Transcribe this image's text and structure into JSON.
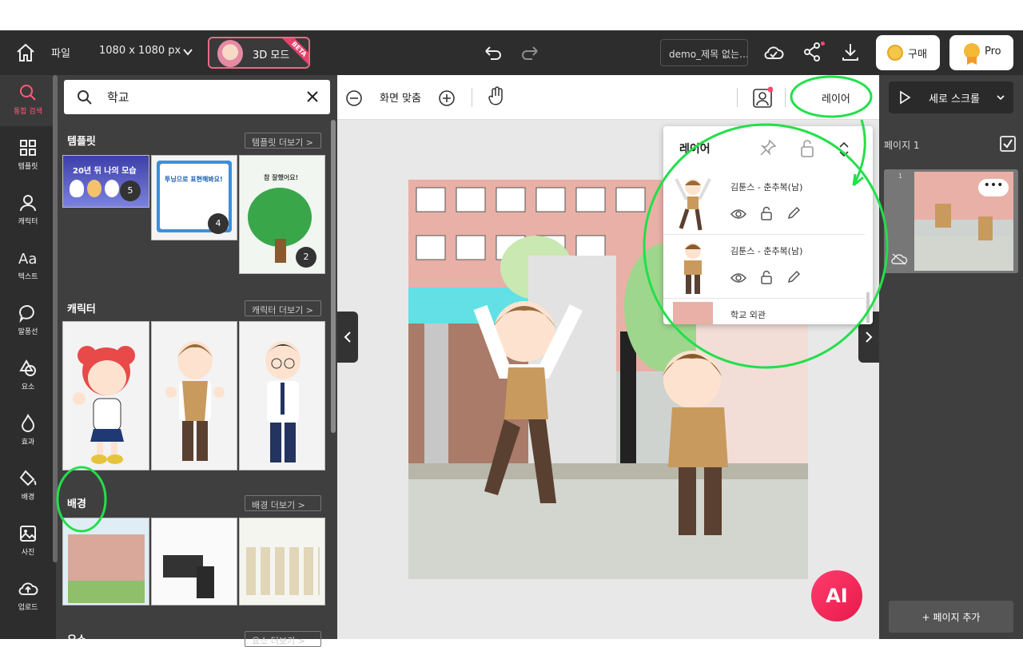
{
  "topbar": {
    "file": "파일",
    "canvas_size": "1080 x 1080 px",
    "mode_3d": "3D 모드",
    "beta": "BETA",
    "doc_title": "demo_제목 없는…",
    "buy": "구매",
    "pro": "Pro"
  },
  "nav": [
    {
      "label": "통합 검색",
      "icon": "search-icon",
      "active": true
    },
    {
      "label": "템플릿",
      "icon": "grid-icon"
    },
    {
      "label": "캐릭터",
      "icon": "person-icon"
    },
    {
      "label": "텍스트",
      "icon": "text-icon"
    },
    {
      "label": "말풍선",
      "icon": "speech-bubble-icon"
    },
    {
      "label": "요소",
      "icon": "shapes-icon"
    },
    {
      "label": "효과",
      "icon": "flame-icon"
    },
    {
      "label": "배경",
      "icon": "paint-bucket-icon"
    },
    {
      "label": "사진",
      "icon": "image-icon"
    },
    {
      "label": "업로드",
      "icon": "upload-cloud-icon"
    }
  ],
  "search": {
    "query": "학교"
  },
  "sections": {
    "templates": {
      "title": "템플릿",
      "more": "템플릿 더보기 >",
      "counts": [
        "5",
        "4",
        "2"
      ],
      "template1_text": "20년 뒤 나의 모습",
      "template2_text": "투닝으로 표현해봐요!",
      "template3_text": "참 잘했어요!"
    },
    "characters": {
      "title": "캐릭터",
      "more": "캐릭터 더보기 >"
    },
    "backgrounds": {
      "title": "배경",
      "more": "배경 더보기 >"
    },
    "next": {
      "title": "요소",
      "more": "요소 더보기 >"
    }
  },
  "canvas_toolbar": {
    "fit": "화면 맞춤",
    "layer": "레이어"
  },
  "layers_panel": {
    "title": "레이어",
    "rows": [
      {
        "name": "김툰스 - 춘추복(남)"
      },
      {
        "name": "김툰스 - 춘추복(남)"
      },
      {
        "name": "학교 외관"
      }
    ]
  },
  "right": {
    "scroll_mode": "세로 스크롤",
    "page_label": "페이지 1",
    "page_num": "1",
    "add_page": "+ 페이지 추가"
  },
  "ai": "AI",
  "colors": {
    "accent": "#ff5a79",
    "annotation": "#22e04a",
    "dark": "#2d2d2d"
  }
}
